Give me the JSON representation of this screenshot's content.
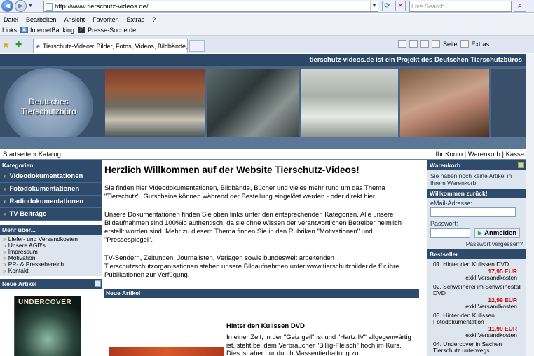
{
  "browser": {
    "url": "http://www.tierschutz-videos.de/",
    "search_placeholder": "Live Search",
    "menu": [
      "Datei",
      "Bearbeiten",
      "Ansicht",
      "Favoriten",
      "Extras",
      "?"
    ],
    "links_label": "Links",
    "link1": "InternetBanking",
    "link2": "Presse-Suche.de",
    "tab_title": "Tierschutz-Videos: Bilder, Fotos, Videos, Bildbände, F...",
    "page_btn": "Seite",
    "extras_btn": "Extras"
  },
  "site": {
    "tagline": "tierschutz-videos.de ist ein Projekt des Deutschen Tierschutzbüros",
    "logo_line1": "Deutsches",
    "logo_line2": "Tierschutzbüro",
    "breadcrumb": "Startseite » Katalog",
    "account_links": "Ihr Konto | Warenkorb | Kasse"
  },
  "left": {
    "categories_header": "Kategorien",
    "categories": [
      "Videodokumentationen",
      "Fotodokumentationen",
      "Radiodokumentationen",
      "TV-Beiträge"
    ],
    "more_header": "Mehr über...",
    "more_items": [
      "Liefer- und Versandkosten",
      "Unsere AGB's",
      "Impressum",
      "Motivation",
      "PR- & Pressebereich",
      "Kontakt"
    ],
    "new_header": "Neue Artikel",
    "cover_text": "UNDERCOVER"
  },
  "main": {
    "welcome": "Herzlich Willkommen auf der Website Tierschutz-Videos!",
    "p1": "Sie finden hier Videodokumentationen, Bildbände, Bücher und vieles mehr rund um das Thema \"Tierschutz\". Gutscheine können während der Bestellung eingelöst werden - oder direkt hier.",
    "p2": "Unsere Dokumentationen finden Sie oben links unter den entsprechenden Kategorien. Alle unsere Bildaufnahmen sind 100%ig authentisch, da sie ohne Wissen der verantwortlichen Betreiber heimlich erstellt worden sind. Mehr zu diesem Thema finden Sie in den Rubriken \"Motivationen\" und \"Pressespiegel\".",
    "p3": "TV-Sendern, Zeitungen, Journalisten, Verlagen sowie bundesweit arbeitenden Tierschutzschutzorganisationen stehen unsere Bildaufnahmen unter www.tierschutzbilder.de für ihre Publikationen zur Verfügung.",
    "new_header": "Neue Artikel",
    "article_title": "Hinter den Kulissen DVD",
    "article_text": "In einer Zeit, in der \"Geiz geil\" ist und \"Hartz IV\" allgegenwärtig ist, steht bei dem Verbraucher \"Billig-Fleisch\" hoch im Kurs. Dies ist aber nur durch Massentierhaltung zu"
  },
  "right": {
    "cart_header": "Warenkorb",
    "cart_text": "Sie haben noch keine Artikel in Ihrem Warenkorb.",
    "welcome_header": "Willkommen zurück!",
    "email_label": "eMail-Adresse:",
    "password_label": "Passwort:",
    "login_button": "Anmelden",
    "forgot": "Passwort vergessen?",
    "best_header": "Bestseller",
    "bestsellers": [
      {
        "title": "01. Hinter den Kulissen DVD",
        "price": "17,95 EUR",
        "ship": "exkl.Versandkosten"
      },
      {
        "title": "02. Schweinerei im Schweinestall DVD",
        "price": "12,99 EUR",
        "ship": "exkl.Versandkosten"
      },
      {
        "title": "03. Hinter den Kulissen Fotodokumentation",
        "price": "11,99 EUR",
        "ship": "exkl.Versandkosten"
      },
      {
        "title": "04. Undercover in Sachen Tierschutz unterwegs",
        "price": "",
        "ship": ""
      }
    ]
  },
  "colors": {
    "header_dark": "#2f4b6c",
    "banner": "#4a6586",
    "price": "#cc0000"
  }
}
